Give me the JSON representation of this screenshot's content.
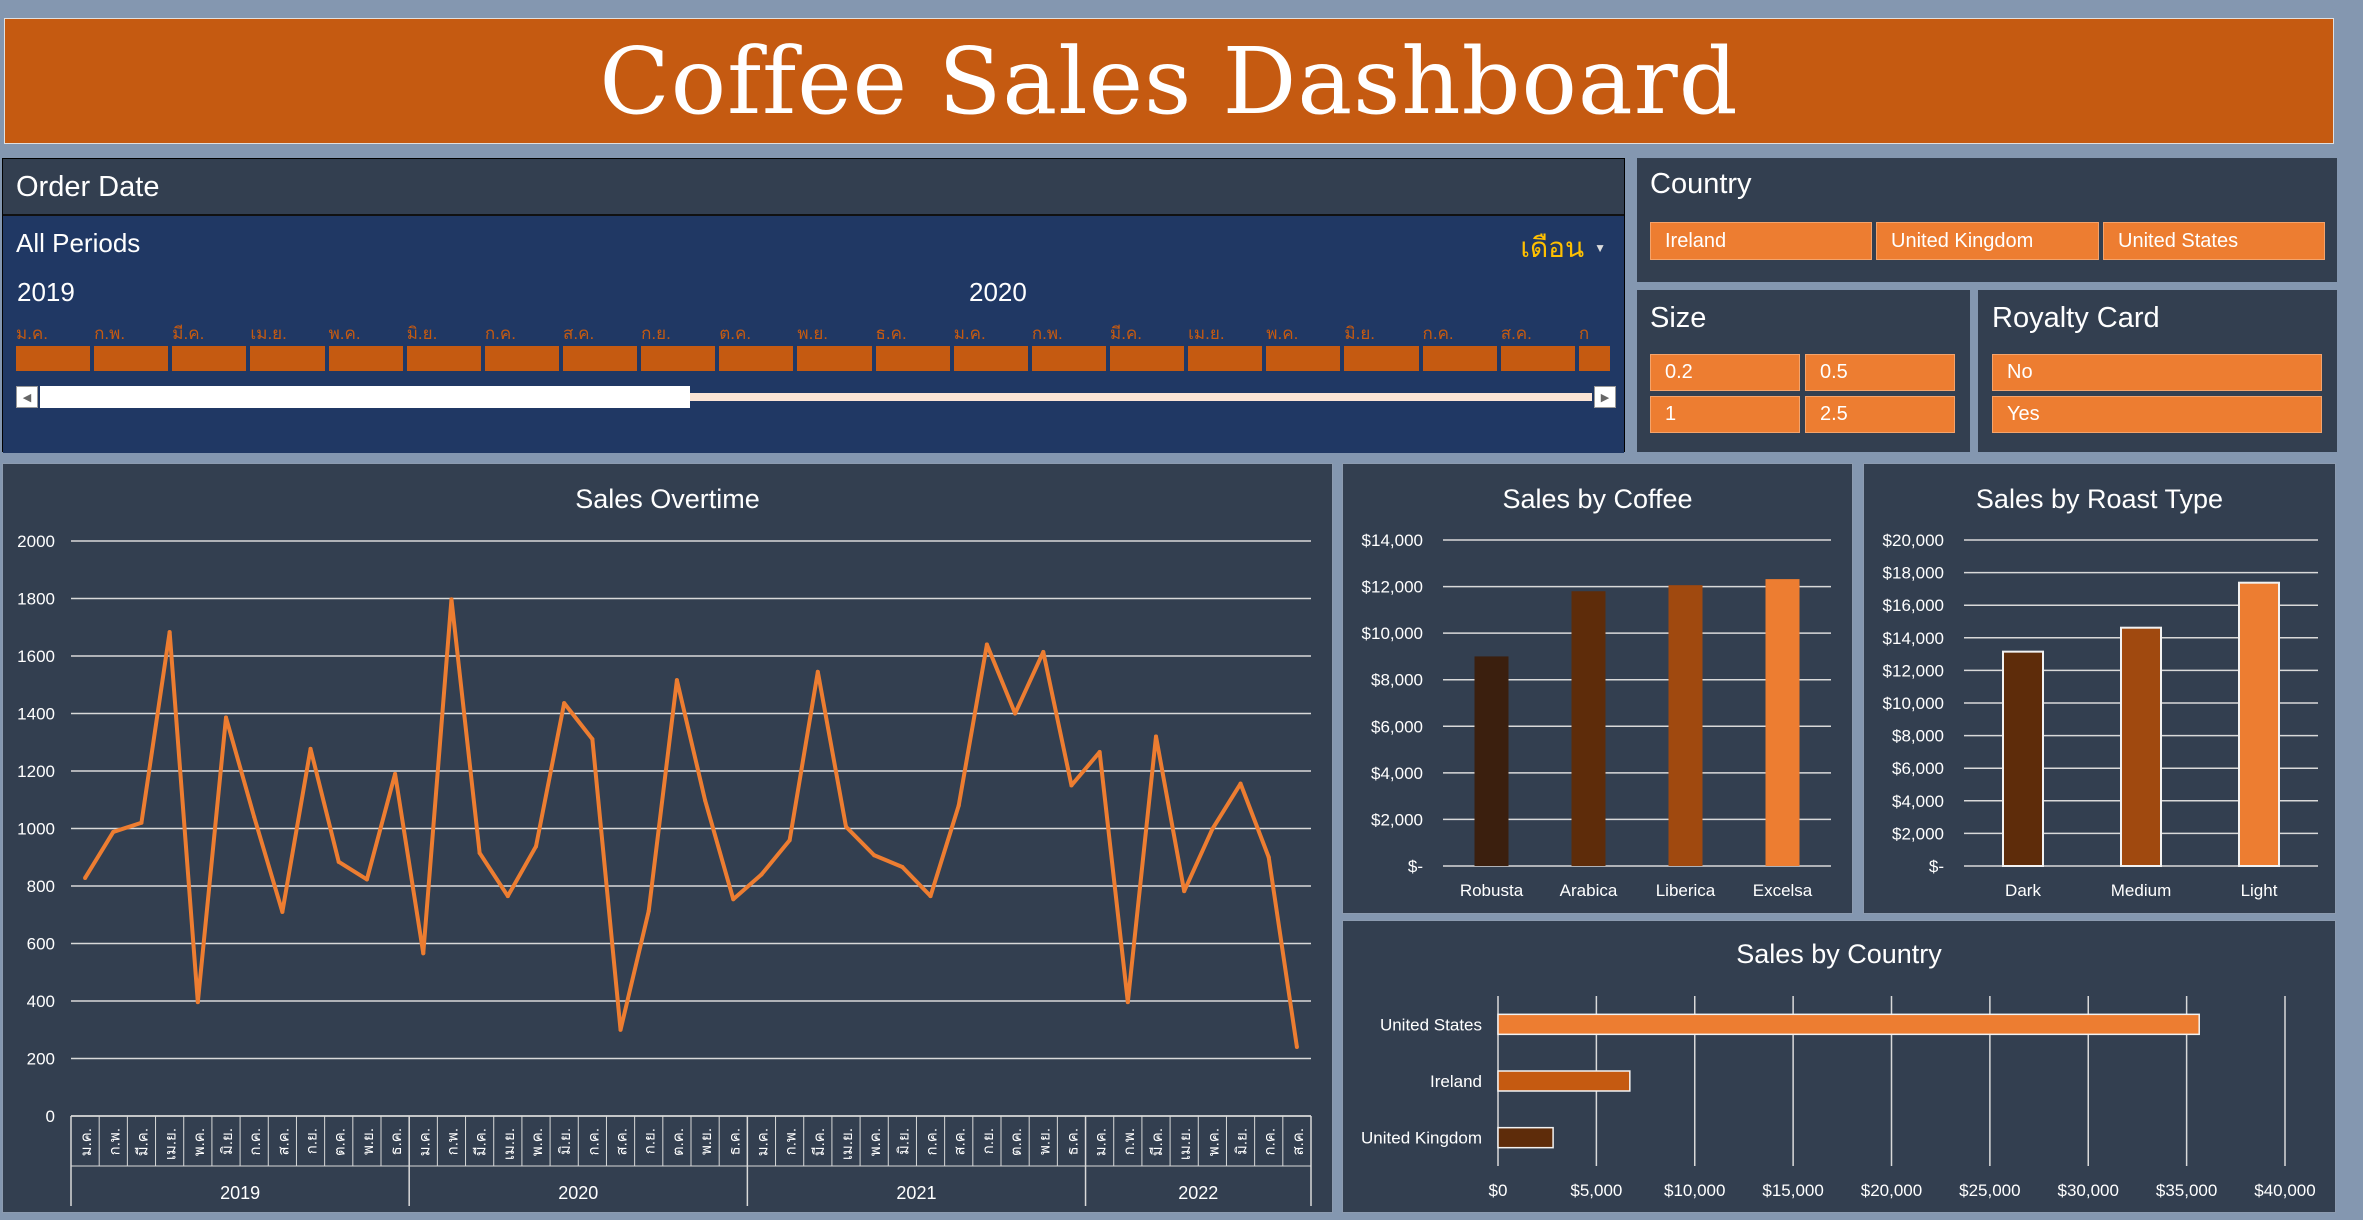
{
  "dashboard_title": "Coffee Sales Dashboard",
  "timeline": {
    "title": "Order Date",
    "period_label": "All Periods",
    "level_label": "เดือน",
    "years": [
      "2019",
      "2020"
    ],
    "months": [
      "ม.ค.",
      "ก.พ.",
      "มี.ค.",
      "เม.ย.",
      "พ.ค.",
      "มิ.ย.",
      "ก.ค.",
      "ส.ค.",
      "ก.ย.",
      "ต.ค.",
      "พ.ย.",
      "ธ.ค.",
      "ม.ค.",
      "ก.พ.",
      "มี.ค.",
      "เม.ย.",
      "พ.ค.",
      "มิ.ย.",
      "ก.ค.",
      "ส.ค.",
      "ก"
    ]
  },
  "country_slicer": {
    "title": "Country",
    "items": [
      "Ireland",
      "United Kingdom",
      "United States"
    ]
  },
  "size_slicer": {
    "title": "Size",
    "items": [
      "0.2",
      "0.5",
      "1",
      "2.5"
    ]
  },
  "royalty_slicer": {
    "title": "Royalty Card",
    "items": [
      "No",
      "Yes"
    ]
  },
  "colors": {
    "background": "#8497b0",
    "panel": "#333f50",
    "banner": "#c55a11",
    "accent": "#ed7d31",
    "timeline_bg": "#203864",
    "dark_brown": "#3b1f0e",
    "brown": "#5e2c0a",
    "mid_brown": "#a0490f"
  },
  "chart_data": [
    {
      "type": "line",
      "title": "Sales Overtime",
      "ylim": [
        0,
        2000
      ],
      "yticks": [
        0,
        200,
        400,
        600,
        800,
        1000,
        1200,
        1400,
        1600,
        1800,
        2000
      ],
      "years": [
        "2019",
        "2020",
        "2021",
        "2022"
      ],
      "months": [
        "ม.ค.",
        "ก.พ.",
        "มี.ค.",
        "เม.ย.",
        "พ.ค.",
        "มิ.ย.",
        "ก.ค.",
        "ส.ค.",
        "ก.ย.",
        "ต.ค.",
        "พ.ย.",
        "ธ.ค."
      ],
      "months_2022": [
        "ม.ค.",
        "ก.พ.",
        "มี.ค.",
        "เม.ย.",
        "พ.ค.",
        "มิ.ย.",
        "ก.ค.",
        "ส.ค."
      ],
      "values": [
        828,
        988,
        1020,
        1683,
        396,
        1386,
        1040,
        710,
        1277,
        884,
        823,
        1190,
        566,
        1797,
        915,
        765,
        938,
        1436,
        1311,
        300,
        713,
        1516,
        1098,
        754,
        840,
        959,
        1545,
        1006,
        907,
        866,
        765,
        1080,
        1640,
        1400,
        1614,
        1150,
        1266,
        396,
        1320,
        782,
        998,
        1156,
        900,
        240
      ]
    },
    {
      "type": "bar",
      "title": "Sales by Coffee",
      "categories": [
        "Robusta",
        "Arabica",
        "Liberica",
        "Excelsa"
      ],
      "values": [
        9000,
        11800,
        12060,
        12320
      ],
      "ylim": [
        0,
        14000
      ],
      "ytick_labels": [
        "$-",
        "$2,000",
        "$4,000",
        "$6,000",
        "$8,000",
        "$10,000",
        "$12,000",
        "$14,000"
      ]
    },
    {
      "type": "bar",
      "title": "Sales by Roast Type",
      "categories": [
        "Dark",
        "Medium",
        "Light"
      ],
      "values": [
        13150,
        14620,
        17380
      ],
      "ylim": [
        0,
        20000
      ],
      "ytick_labels": [
        "$-",
        "$2,000",
        "$4,000",
        "$6,000",
        "$8,000",
        "$10,000",
        "$12,000",
        "$14,000",
        "$16,000",
        "$18,000",
        "$20,000"
      ]
    },
    {
      "type": "bar",
      "orientation": "horizontal",
      "title": "Sales by Country",
      "categories": [
        "United States",
        "Ireland",
        "United Kingdom"
      ],
      "values": [
        35640,
        6700,
        2800
      ],
      "xlim": [
        0,
        40000
      ],
      "xtick_labels": [
        "$0",
        "$5,000",
        "$10,000",
        "$15,000",
        "$20,000",
        "$25,000",
        "$30,000",
        "$35,000",
        "$40,000"
      ]
    }
  ]
}
